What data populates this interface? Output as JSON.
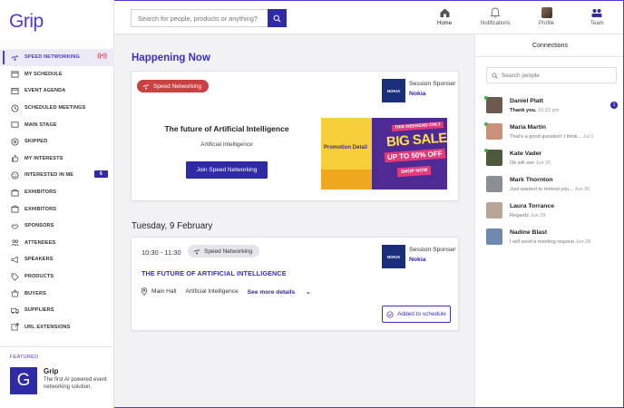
{
  "brand": {
    "logo_text": "Grip",
    "accent": "#2f2aa6"
  },
  "sidebar": {
    "items": [
      {
        "label": "SPEED NETWORKING",
        "icon": "speed-networking-icon",
        "active": true
      },
      {
        "label": "MY SCHEDULE",
        "icon": "calendar-icon"
      },
      {
        "label": "EVENT AGENDA",
        "icon": "agenda-icon"
      },
      {
        "label": "SCHEDULED MEETINGS",
        "icon": "clock-icon"
      },
      {
        "label": "MAIN STAGE",
        "icon": "stage-icon"
      },
      {
        "label": "SKIPPED",
        "icon": "skipped-icon"
      },
      {
        "label": "MY INTERESTS",
        "icon": "thumbs-up-icon"
      },
      {
        "label": "INTERESTED IN ME",
        "icon": "smiley-icon",
        "badge": "6"
      },
      {
        "label": "EXHIBITORS",
        "icon": "exhibitor-icon"
      },
      {
        "label": "EXHIBITORS",
        "icon": "exhibitor-icon"
      },
      {
        "label": "SPONSORS",
        "icon": "handshake-icon"
      },
      {
        "label": "ATTENDEES",
        "icon": "attendees-icon"
      },
      {
        "label": "SPEAKERS",
        "icon": "megaphone-icon"
      },
      {
        "label": "PRODUCTS",
        "icon": "tag-icon"
      },
      {
        "label": "BUYERS",
        "icon": "basket-icon"
      },
      {
        "label": "SUPPLIERS",
        "icon": "truck-icon"
      },
      {
        "label": "URL EXTENSIONS",
        "icon": "external-link-icon"
      }
    ],
    "featured": {
      "label": "FEATURED",
      "logo_letter": "G",
      "name": "Grip",
      "description": "The first AI powered event networking solution."
    }
  },
  "topbar": {
    "search_placeholder": "Search for people, products or anything?",
    "nav": [
      {
        "label": "Home",
        "icon": "home-icon"
      },
      {
        "label": "Notifications",
        "icon": "bell-icon"
      },
      {
        "label": "Profile",
        "icon": "avatar"
      },
      {
        "label": "Team",
        "icon": "team-icon"
      }
    ]
  },
  "main": {
    "heading": "Happening Now",
    "featured_session": {
      "tag": "Speed Networking",
      "sponsor_label": "Session Sponser",
      "sponsor_name": "Nokia",
      "sponsor_logo_text": "NOKIA",
      "title": "The future of Artificial Intelligence",
      "subtitle": "Artificial Intelligence",
      "button": "Join Speed Networking",
      "banner": {
        "promo": "Promotion Detail",
        "top": "THIS WEEKEND ONLY",
        "big": "BIG SALE",
        "off": "UP TO 50% OFF",
        "shop": "SHOP NOW"
      }
    },
    "date_heading": "Tuesday, 9 February",
    "session": {
      "time": "10:30 - 11:30",
      "tag": "Speed Networking",
      "sponsor_label": "Session Sponser",
      "sponsor_name": "Nokia",
      "sponsor_logo_text": "NOKIA",
      "title": "THE FUTURE OF ARTIFICIAL INTELLIGENCE",
      "location": "Main Hall",
      "topic": "Artificial Intelligence",
      "see_more": "See more details",
      "added": "Added to schedule"
    }
  },
  "connections": {
    "title": "Connections",
    "search_placeholder": "Search people",
    "list": [
      {
        "name": "Daniel Platt",
        "message": "Thank you.",
        "time": "16:22 pm",
        "unread": "1",
        "online": true,
        "color": "#6b5a4e"
      },
      {
        "name": "Maria Martin",
        "message": "That's a good question! I think...",
        "time": "Jul 1",
        "online": true,
        "color": "#c9907a"
      },
      {
        "name": "Kate Vader",
        "message": "Ok will see",
        "time": "Jun 30",
        "online": true,
        "color": "#4d5a3c"
      },
      {
        "name": "Mark Thornton",
        "message": "Just wanted to remind you...",
        "time": "Jun 30",
        "online": false,
        "color": "#8a8f96"
      },
      {
        "name": "Laura Torrance",
        "message": "Regards",
        "time": "Jun 29",
        "online": false,
        "color": "#b7a597"
      },
      {
        "name": "Nadine Blast",
        "message": "I will send a meeting request",
        "time": "Jun 28",
        "online": false,
        "color": "#6f8ab0"
      }
    ]
  }
}
